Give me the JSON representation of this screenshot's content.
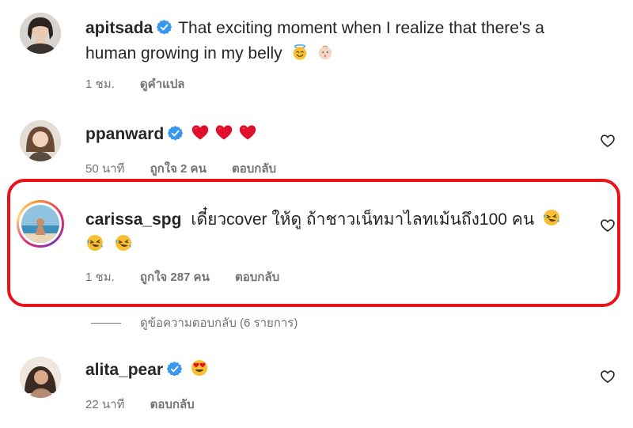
{
  "comments": [
    {
      "username": "apitsada",
      "verified": true,
      "text_line1": "That exciting moment when I realize that there's a",
      "text_line2": "human growing in my belly",
      "emojis_line2": [
        "smiling-face-with-halo",
        "baby"
      ],
      "time": "1 ชม.",
      "action": "ดูคำแปล"
    },
    {
      "username": "ppanward",
      "verified": true,
      "emojis": [
        "red-heart",
        "red-heart",
        "red-heart"
      ],
      "time": "50 นาที",
      "likes": "ถูกใจ 2 คน",
      "reply": "ตอบกลับ"
    },
    {
      "username": "carissa_spg",
      "verified": false,
      "text_line1": "เดี๋ยวcover ให้ดู ถ้าชาวเน็ทมาไลทเม้นถึง100 คน",
      "emojis_line1": [
        "rolling-on-floor-laughing"
      ],
      "emojis_line2": [
        "rolling-on-floor-laughing",
        "rolling-on-floor-laughing"
      ],
      "time": "1 ชม.",
      "likes": "ถูกใจ 287 คน",
      "reply": "ตอบกลับ"
    },
    {
      "username": "alita_pear",
      "verified": true,
      "emojis": [
        "heart-eyes"
      ],
      "time": "22 นาที",
      "reply": "ตอบกลับ"
    }
  ],
  "view_replies": "ดูข้อความตอบกลับ (6 รายการ)",
  "colors": {
    "verified": "#3897f0",
    "highlight": "#e8141a",
    "meta": "#737373"
  }
}
